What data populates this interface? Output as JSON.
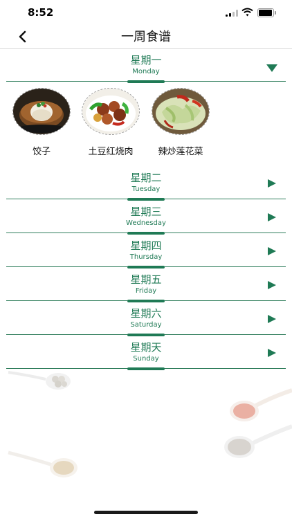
{
  "status": {
    "time": "8:52"
  },
  "nav": {
    "title": "一周食谱"
  },
  "days": [
    {
      "cn": "星期一",
      "en": "Monday",
      "expanded": true
    },
    {
      "cn": "星期二",
      "en": "Tuesday",
      "expanded": false
    },
    {
      "cn": "星期三",
      "en": "Wednesday",
      "expanded": false
    },
    {
      "cn": "星期四",
      "en": "Thursday",
      "expanded": false
    },
    {
      "cn": "星期五",
      "en": "Friday",
      "expanded": false
    },
    {
      "cn": "星期六",
      "en": "Saturday",
      "expanded": false
    },
    {
      "cn": "星期天",
      "en": "Sunday",
      "expanded": false
    }
  ],
  "dishes": [
    {
      "name": "饺子"
    },
    {
      "name": "土豆红烧肉"
    },
    {
      "name": "辣炒莲花菜"
    }
  ],
  "colors": {
    "accent": "#1f7a55",
    "divider": "#2e7d5b",
    "nav_border": "#d9d9d9"
  },
  "icons": [
    "back-chevron-icon",
    "play-triangle-icon",
    "down-triangle-icon",
    "wifi-icon",
    "battery-icon",
    "signal-icon"
  ]
}
